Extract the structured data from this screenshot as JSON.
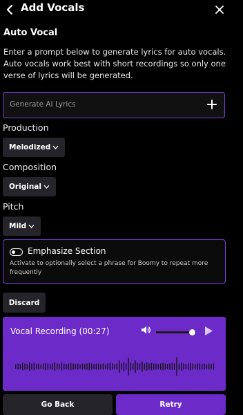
{
  "header": {
    "title": "Add Vocals",
    "back_icon": "chevron-left-icon",
    "close_icon": "close-icon"
  },
  "auto_vocal": {
    "title": "Auto Vocal",
    "description": "Enter a prompt below to generate lyrics for auto vocals. Auto vocals work best with short recordings so only one verse of lyrics will be generated.",
    "lyrics_placeholder": "Generate AI Lyrics",
    "add_icon": "plus-icon"
  },
  "production": {
    "label": "Production",
    "value": "Melodized"
  },
  "composition": {
    "label": "Composition",
    "value": "Original"
  },
  "pitch": {
    "label": "Pitch",
    "value": "Mild"
  },
  "emphasize": {
    "title": "Emphasize Section",
    "description": "Activate to optionally select a phrase for Boomy to repeat more frequently",
    "enabled": false
  },
  "discard_label": "Discard",
  "player": {
    "label": "Vocal Recording (00:27)",
    "volume": 0.9,
    "volume_icon": "volume-icon",
    "play_icon": "play-icon",
    "waveform": [
      0.2,
      0.3,
      0.25,
      0.35,
      0.3,
      0.25,
      0.4,
      0.3,
      0.35,
      0.25,
      0.3,
      0.2,
      0.3,
      0.35,
      0.3,
      0.25,
      0.3,
      0.4,
      0.3,
      0.25,
      0.35,
      0.3,
      0.25,
      0.3,
      0.35,
      0.3,
      0.25,
      0.3,
      0.2,
      0.3,
      0.25,
      0.3,
      0.35,
      0.3,
      0.25,
      0.3,
      0.3,
      0.25,
      0.3,
      0.2,
      0.3,
      0.35,
      0.3,
      0.25,
      0.3,
      0.6,
      0.3,
      0.45,
      0.3,
      0.85,
      0.4,
      0.3,
      0.6,
      0.35,
      0.3,
      0.5,
      0.3,
      0.4,
      0.3,
      0.35,
      0.3,
      0.3,
      0.25,
      0.3,
      0.35,
      0.3,
      0.25,
      0.3,
      0.35,
      0.3,
      0.9,
      0.3,
      0.4,
      0.3,
      0.25,
      0.3,
      0.35,
      0.3,
      0.25,
      0.3,
      0.3,
      0.25,
      0.3,
      0.2,
      0.3,
      0.25,
      0.3
    ]
  },
  "buttons": {
    "go_back": "Go Back",
    "retry": "Retry"
  },
  "colors": {
    "accent": "#6c2bc9",
    "border_accent": "#7b3ee0",
    "dark_button": "#25242a"
  }
}
